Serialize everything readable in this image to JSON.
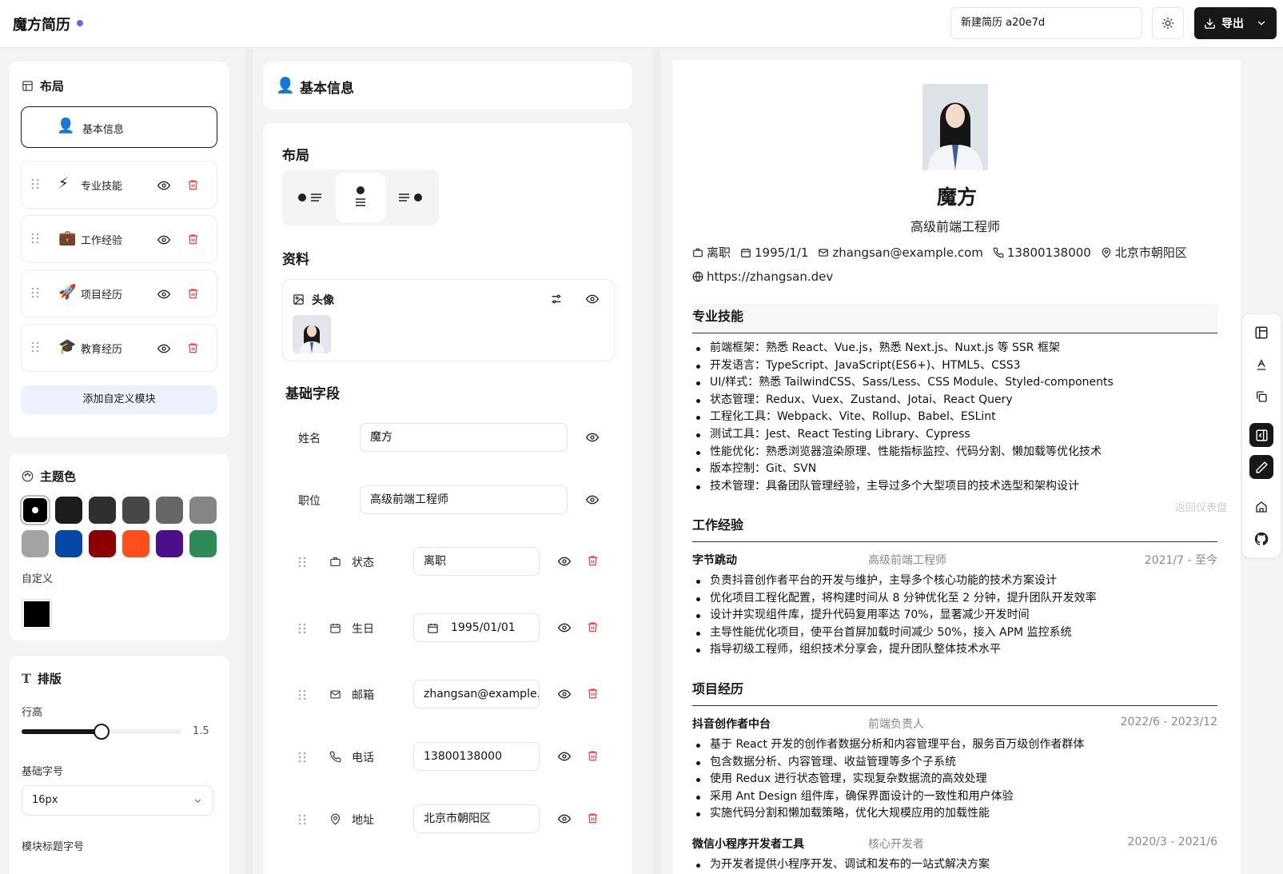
{
  "header": {
    "logo": "魔方简历",
    "resume_name": "新建简历 a20e7d",
    "export_label": "导出"
  },
  "left": {
    "layout_title": "布局",
    "modules": [
      {
        "icon": "👤",
        "label": "基本信息",
        "active": true
      },
      {
        "icon": "⚡",
        "label": "专业技能"
      },
      {
        "icon": "💼",
        "label": "工作经验"
      },
      {
        "icon": "🚀",
        "label": "项目经历"
      },
      {
        "icon": "🎓",
        "label": "教育经历"
      }
    ],
    "add_custom": "添加自定义模块",
    "theme_title": "主题色",
    "theme_colors": [
      "#000000",
      "#1c1c1c",
      "#2f2f2f",
      "#474747",
      "#666666",
      "#858585",
      "#a3a3a3",
      "#0747a6",
      "#8b0000",
      "#ff4f1f",
      "#4b0f8b",
      "#2e8b57"
    ],
    "custom_label": "自定义",
    "custom_color": "#000000",
    "typo_title": "排版",
    "line_height_label": "行高",
    "line_height_value": "1.5",
    "line_height_ratio": 0.5,
    "base_font_label": "基础字号",
    "base_font_value": "16px",
    "section_font_label": "模块标题字号"
  },
  "middle": {
    "title": "基本信息",
    "title_icon": "👤",
    "layout_label": "布局",
    "profile_label": "资料",
    "avatar_label": "头像",
    "basic_fields_label": "基础字段",
    "name_label": "姓名",
    "name_value": "魔方",
    "title_label": "职位",
    "title_value": "高级前端工程师",
    "fields": [
      {
        "icon": "briefcase-icon",
        "label": "状态",
        "value": "离职"
      },
      {
        "icon": "calendar-icon",
        "label": "生日",
        "value": "1995/01/01"
      },
      {
        "icon": "mail-icon",
        "label": "邮箱",
        "value": "zhangsan@example.com"
      },
      {
        "icon": "phone-icon",
        "label": "电话",
        "value": "13800138000"
      },
      {
        "icon": "map-pin-icon",
        "label": "地址",
        "value": "北京市朝阳区"
      }
    ]
  },
  "resume": {
    "name": "魔方",
    "title": "高级前端工程师",
    "status": "离职",
    "birthday": "1995/1/1",
    "email": "zhangsan@example.com",
    "phone": "13800138000",
    "address": "北京市朝阳区",
    "website": "https://zhangsan.dev",
    "skills_title": "专业技能",
    "skills": [
      "前端框架：熟悉 React、Vue.js，熟悉 Next.js、Nuxt.js 等 SSR 框架",
      "开发语言：TypeScript、JavaScript(ES6+)、HTML5、CSS3",
      "UI/样式：熟悉 TailwindCSS、Sass/Less、CSS Module、Styled-components",
      "状态管理：Redux、Vuex、Zustand、Jotai、React Query",
      "工程化工具：Webpack、Vite、Rollup、Babel、ESLint",
      "测试工具：Jest、React Testing Library、Cypress",
      "性能优化：熟悉浏览器渲染原理、性能指标监控、代码分割、懒加载等优化技术",
      "版本控制：Git、SVN",
      "技术管理：具备团队管理经验，主导过多个大型项目的技术选型和架构设计"
    ],
    "work_title": "工作经验",
    "work": [
      {
        "company": "字节跳动",
        "role": "高级前端工程师",
        "date": "2021/7 - 至今",
        "items": [
          "负责抖音创作者平台的开发与维护，主导多个核心功能的技术方案设计",
          "优化项目工程化配置，将构建时间从 8 分钟优化至 2 分钟，提升团队开发效率",
          "设计并实现组件库，提升代码复用率达 70%，显著减少开发时间",
          "主导性能优化项目，使平台首屏加载时间减少 50%，接入 APM 监控系统",
          "指导初级工程师，组织技术分享会，提升团队整体技术水平"
        ]
      }
    ],
    "project_title": "项目经历",
    "projects": [
      {
        "name": "抖音创作者中台",
        "role": "前端负责人",
        "date": "2022/6 - 2023/12",
        "items": [
          "基于 React 开发的创作者数据分析和内容管理平台，服务百万级创作者群体",
          "包含数据分析、内容管理、收益管理等多个子系统",
          "使用 Redux 进行状态管理，实现复杂数据流的高效处理",
          "采用 Ant Design 组件库，确保界面设计的一致性和用户体验",
          "实施代码分割和懒加载策略，优化大规模应用的加载性能"
        ]
      },
      {
        "name": "微信小程序开发者工具",
        "role": "核心开发者",
        "date": "2020/3 - 2021/6",
        "items": [
          "为开发者提供小程序开发、调试和发布的一站式解决方案"
        ]
      }
    ]
  },
  "ghost_text": "返回仪表盘"
}
